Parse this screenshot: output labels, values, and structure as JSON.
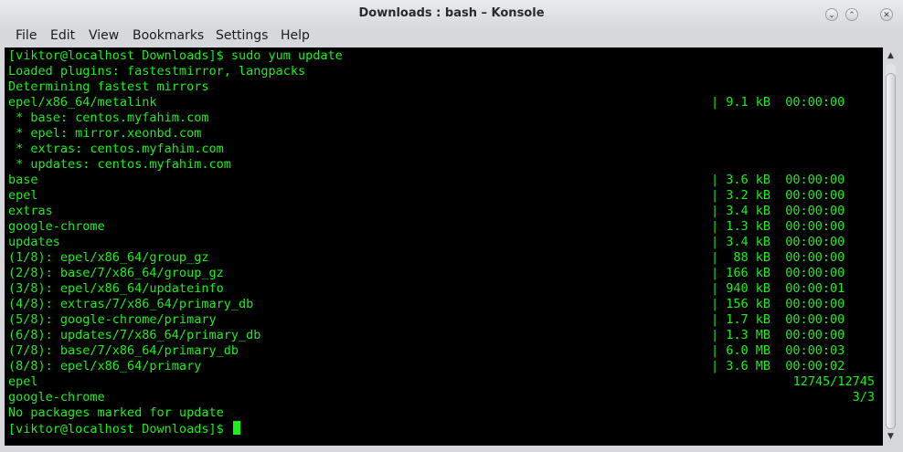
{
  "window": {
    "title": "Downloads : bash – Konsole",
    "buttons": {
      "help_icon": "⌄",
      "maximize_icon": "⌃",
      "close_icon": "✕"
    }
  },
  "menu": [
    "File",
    "Edit",
    "View",
    "Bookmarks",
    "Settings",
    "Help"
  ],
  "colors": {
    "terminal_bg": "#000000",
    "terminal_fg": "#18f018"
  },
  "terminal": {
    "lines": [
      {
        "text": "[viktor@localhost Downloads]$ sudo yum update"
      },
      {
        "text": "Loaded plugins: fastestmirror, langpacks"
      },
      {
        "text": "Determining fastest mirrors"
      },
      {
        "text": "epel/x86_64/metalink",
        "size": "| 9.1 kB  00:00:00"
      },
      {
        "text": " * base: centos.myfahim.com"
      },
      {
        "text": " * epel: mirror.xeonbd.com"
      },
      {
        "text": " * extras: centos.myfahim.com"
      },
      {
        "text": " * updates: centos.myfahim.com"
      },
      {
        "text": "base",
        "size": "| 3.6 kB  00:00:00"
      },
      {
        "text": "epel",
        "size": "| 3.2 kB  00:00:00"
      },
      {
        "text": "extras",
        "size": "| 3.4 kB  00:00:00"
      },
      {
        "text": "google-chrome",
        "size": "| 1.3 kB  00:00:00"
      },
      {
        "text": "updates",
        "size": "| 3.4 kB  00:00:00"
      },
      {
        "text": "(1/8): epel/x86_64/group_gz",
        "size": "|  88 kB  00:00:00"
      },
      {
        "text": "(2/8): base/7/x86_64/group_gz",
        "size": "| 166 kB  00:00:00"
      },
      {
        "text": "(3/8): epel/x86_64/updateinfo",
        "size": "| 940 kB  00:00:01"
      },
      {
        "text": "(4/8): extras/7/x86_64/primary_db",
        "size": "| 156 kB  00:00:00"
      },
      {
        "text": "(5/8): google-chrome/primary",
        "size": "| 1.7 kB  00:00:00"
      },
      {
        "text": "(6/8): updates/7/x86_64/primary_db",
        "size": "| 1.3 MB  00:00:00"
      },
      {
        "text": "(7/8): base/7/x86_64/primary_db",
        "size": "| 6.0 MB  00:00:03"
      },
      {
        "text": "(8/8): epel/x86_64/primary",
        "size": "| 3.6 MB  00:00:02"
      },
      {
        "text": "epel",
        "count": "12745/12745"
      },
      {
        "text": "google-chrome",
        "count": "3/3"
      },
      {
        "text": "No packages marked for update"
      },
      {
        "text": "[viktor@localhost Downloads]$ ",
        "cursor": true
      }
    ]
  },
  "scrollbar": {
    "up_icon": "▲",
    "down_icon": "▼"
  }
}
